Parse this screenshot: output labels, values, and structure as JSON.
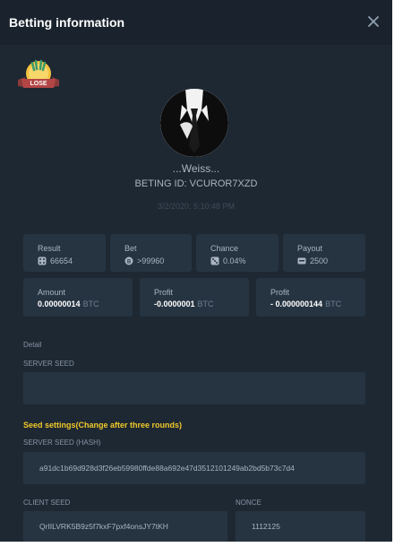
{
  "modal": {
    "title": "Betting information",
    "close_icon": "close-icon",
    "badge_label": "LOSE"
  },
  "player": {
    "username": "...Weiss...",
    "betting_id": "BETING ID: VCUROR7XZD",
    "timestamp": "3/2/2020, 5:10:48 PM"
  },
  "stats": [
    {
      "label": "Result",
      "value": "66654",
      "icon": "dice-icon"
    },
    {
      "label": "Bet",
      "value": ">99960",
      "icon": "coin-icon"
    },
    {
      "label": "Chance",
      "value": "0.04%",
      "icon": "dice-icon"
    },
    {
      "label": "Payout",
      "value": "2500",
      "icon": "payout-icon"
    }
  ],
  "amounts": [
    {
      "label": "Amount",
      "value": "0.00000014",
      "unit": "BTC"
    },
    {
      "label": "Profit",
      "value": "-0.0000001",
      "unit": "BTC"
    },
    {
      "label": "Profit",
      "value": "- 0.000000144",
      "unit": "BTC"
    }
  ],
  "detail": {
    "label": "Detail",
    "server_seed_label": "SERVER SEED",
    "server_seed_value": "",
    "seed_settings_label": "Seed settings(Change after three rounds)",
    "server_seed_hash_label": "SERVER SEED (HASH)",
    "server_seed_hash_value": "a91dc1b69d928d3f26eb59980ffde88a692e47d3512101249ab2bd5b73c7d4",
    "client_seed_label": "CLIENT SEED",
    "client_seed_value": "QrIILVRK5B9z5f7kxF7pxf4onsJY7tKH",
    "nonce_label": "NONCE",
    "nonce_value": "1112125"
  },
  "colors": {
    "background": "#1e2833",
    "card": "#263442",
    "accent": "#f0c929",
    "text": "#a9b4c0"
  }
}
